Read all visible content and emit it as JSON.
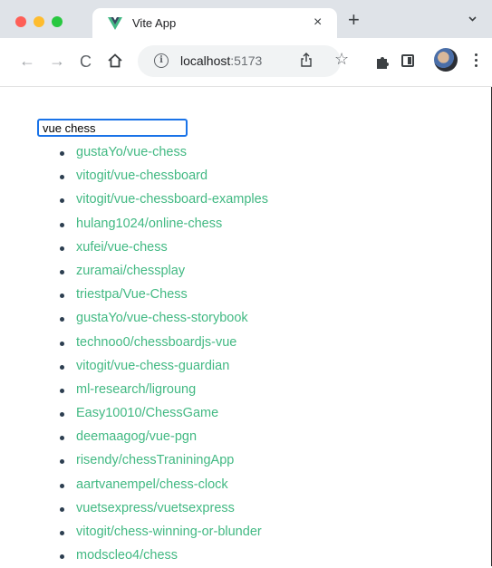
{
  "browser": {
    "tab_title": "Vite App",
    "tab_close": "×",
    "new_tab": "+",
    "url_host": "localhost",
    "url_port": ":5173",
    "icons": [
      "close-red",
      "minimize-yellow",
      "zoom-green",
      "vue-favicon",
      "chevron-down-icon",
      "back-arrow-icon",
      "forward-arrow-icon",
      "reload-icon",
      "home-icon",
      "info-icon",
      "share-icon",
      "star-icon",
      "extensions-icon",
      "side-panel-icon",
      "avatar",
      "menu-icon"
    ]
  },
  "search": {
    "value": "vue chess"
  },
  "results": [
    "gustaYo/vue-chess",
    "vitogit/vue-chessboard",
    "vitogit/vue-chessboard-examples",
    "hulang1024/online-chess",
    "xufei/vue-chess",
    "zuramai/chessplay",
    "triestpa/Vue-Chess",
    "gustaYo/vue-chess-storybook",
    "technoo0/chessboardjs-vue",
    "vitogit/vue-chess-guardian",
    "ml-research/ligroung",
    "Easy10010/ChessGame",
    "deemaagog/vue-pgn",
    "risendy/chessTraniningApp",
    "aartvanempel/chess-clock",
    "vuetsexpress/vuetsexpress",
    "vitogit/chess-winning-or-blunder",
    "modscleo4/chess"
  ],
  "colors": {
    "link": "#42b983",
    "focus_ring": "#1a73e8",
    "tab_strip": "#dfe3e8"
  }
}
